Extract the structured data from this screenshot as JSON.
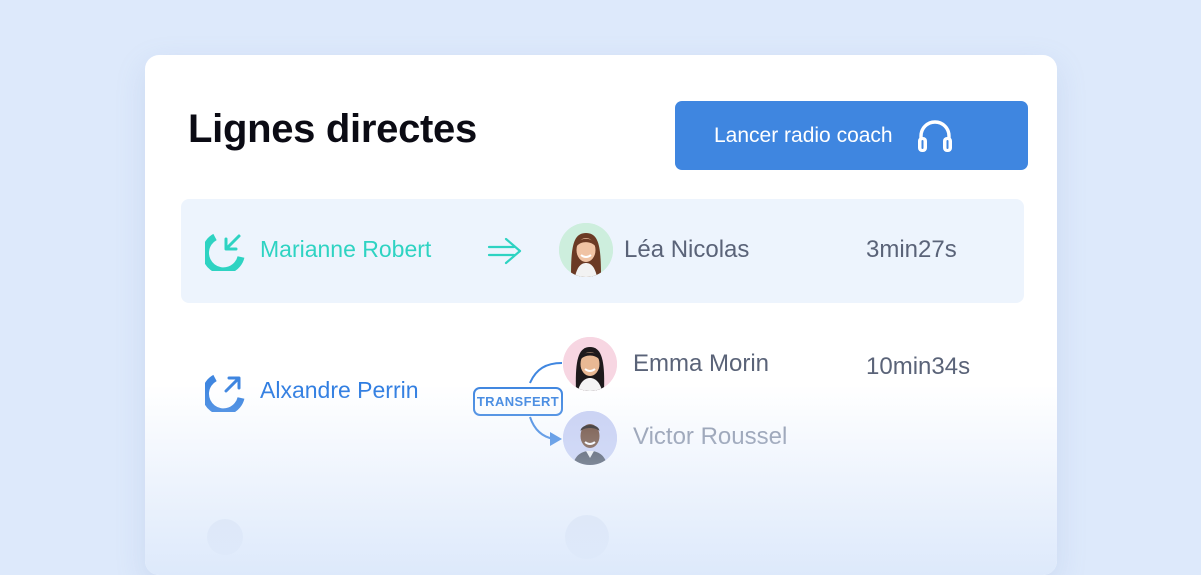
{
  "header": {
    "title": "Lignes directes",
    "coach_button_label": "Lancer radio coach"
  },
  "calls": [
    {
      "direction": "incoming",
      "caller": "Marianne Robert",
      "agent": "Léa Nicolas",
      "duration": "3min27s",
      "highlighted": true
    },
    {
      "direction": "outgoing",
      "caller": "Alxandre Perrin",
      "agents": [
        "Emma Morin",
        "Victor Roussel"
      ],
      "transfer_label": "TRANSFERT",
      "duration": "10min34s",
      "highlighted": false
    }
  ],
  "icons": {
    "coach": "headphones-icon",
    "incoming": "incoming-call-icon",
    "outgoing": "outgoing-call-icon",
    "forward": "arrow-right-icon",
    "transfer": "transfer-arrow-icon"
  },
  "colors": {
    "background": "#dde9fb",
    "primary": "#3f86e0",
    "incoming": "#2ed3c2",
    "outgoing": "#3f86e0",
    "row_highlight": "#edf4fd",
    "text_muted": "#5a6378"
  }
}
